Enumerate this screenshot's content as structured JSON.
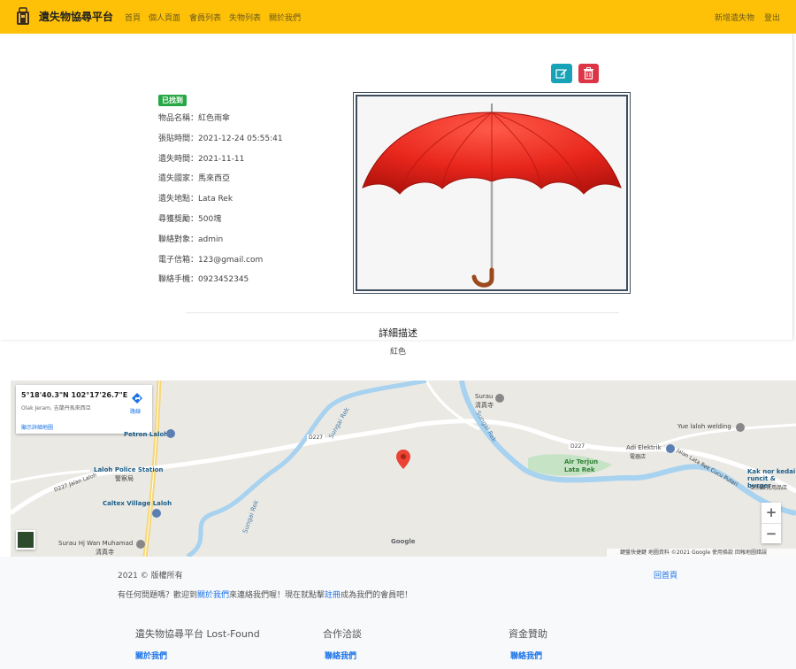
{
  "navbar": {
    "brand": "遺失物協尋平台",
    "links": [
      "首頁",
      "個人頁面",
      "會員列表",
      "失物列表",
      "關於我們"
    ],
    "right_links": [
      "新增遺失物",
      "登出"
    ],
    "bg_color": "#ffc107"
  },
  "item": {
    "status": "已找到",
    "fields": [
      {
        "label": "物品名稱：",
        "value": "紅色雨傘"
      },
      {
        "label": "張貼時間：",
        "value": "2021-12-24 05:55:41"
      },
      {
        "label": "遺失時間：",
        "value": "2021-11-11"
      },
      {
        "label": "遺失國家：",
        "value": "馬來西亞"
      },
      {
        "label": "遺失地點：",
        "value": "Lata Rek"
      },
      {
        "label": "尋獲獎勵：",
        "value": "500塊"
      },
      {
        "label": "聯絡對象：",
        "value": "admin"
      },
      {
        "label": "電子信箱：",
        "value": "123@gmail.com"
      },
      {
        "label": "聯絡手機：",
        "value": "0923452345"
      }
    ],
    "image_icon": "red-umbrella"
  },
  "actions": {
    "edit_icon": "edit-icon",
    "delete_icon": "trash-icon"
  },
  "description": {
    "title": "詳細描述",
    "body": "紅色"
  },
  "map": {
    "coords": "5°18'40.3\"N 102°17'26.7\"E",
    "address": "Olak Jeram, 吉蘭丹馬來西亞",
    "directions": "路線",
    "larger_map": "顯示詳細地圖",
    "labels": {
      "petron": "Petron Laloh",
      "police": "Laloh Police Station",
      "police_sub": "警察局",
      "caltex": "Caltex Village Laloh",
      "surau_hj": "Surau Hj Wan Muhamad",
      "surau_hj_sub": "清真寺",
      "surau": "Surau",
      "surau_sub": "清真寺",
      "sungai_rek_1": "Sungai Rek",
      "sungai_rek_2": "Sungai Rek",
      "sungai_rek_3": "Sungai Rek",
      "d227_a": "D227",
      "d227_b": "D227",
      "jalan_laloh": "D227 Jalan Laloh",
      "yue_laloh": "Yue laloh welding",
      "adi": "Adi Elektrik",
      "adi_sub": "電器店",
      "air_terjun": "Air Terjun Lata Rek",
      "kak_nor": "Kak nor kedai runcit & burger",
      "kak_nor_sub": "亞洲雜貨用品店",
      "jalan_lata": "Jalan Lata Rek Cucu Puteri",
      "google": "Google"
    },
    "attribution": "鍵盤快捷鍵  地圖資料 ©2021 Google  使用條款  回報地圖錯誤",
    "zoom_in": "+",
    "zoom_out": "−"
  },
  "footer": {
    "copyright": "2021 © 版權所有",
    "home_link": "回首頁",
    "message_prefix": "有任何問題嗎？歡迎到",
    "message_link1": "關於我們",
    "message_mid": "來連絡我們喔！現在就點擊",
    "message_link2": "註冊",
    "message_suffix": "成為我們的會員吧！",
    "columns": [
      {
        "heading": "遺失物協尋平台 Lost-Found",
        "link": "關於我們"
      },
      {
        "heading": "合作洽談",
        "link": "聯絡我們"
      },
      {
        "heading": "資金贊助",
        "link": "聯絡我們"
      }
    ]
  }
}
